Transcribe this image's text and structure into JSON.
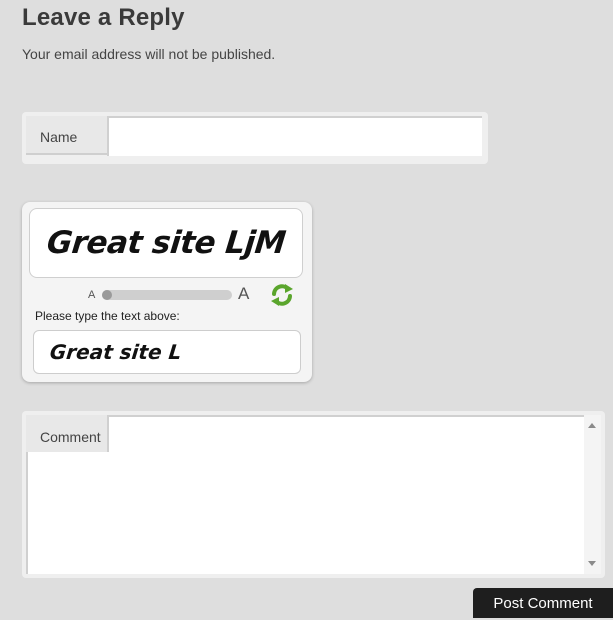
{
  "reply": {
    "title": "Leave a Reply",
    "note": "Your email address will not be published."
  },
  "name_field": {
    "label": "Name",
    "value": ""
  },
  "captcha": {
    "image_text": "Great site LjM",
    "size_small": "A",
    "size_large": "A",
    "size_level": 0,
    "refresh_icon": "refresh-icon",
    "prompt": "Please type the text above:",
    "typed": "Great site L"
  },
  "comment_field": {
    "label": "Comment",
    "value": ""
  },
  "submit": {
    "label": "Post Comment"
  },
  "colors": {
    "background": "#dedede",
    "button": "#1e1e1e",
    "refresh_green": "#5aa52c"
  }
}
